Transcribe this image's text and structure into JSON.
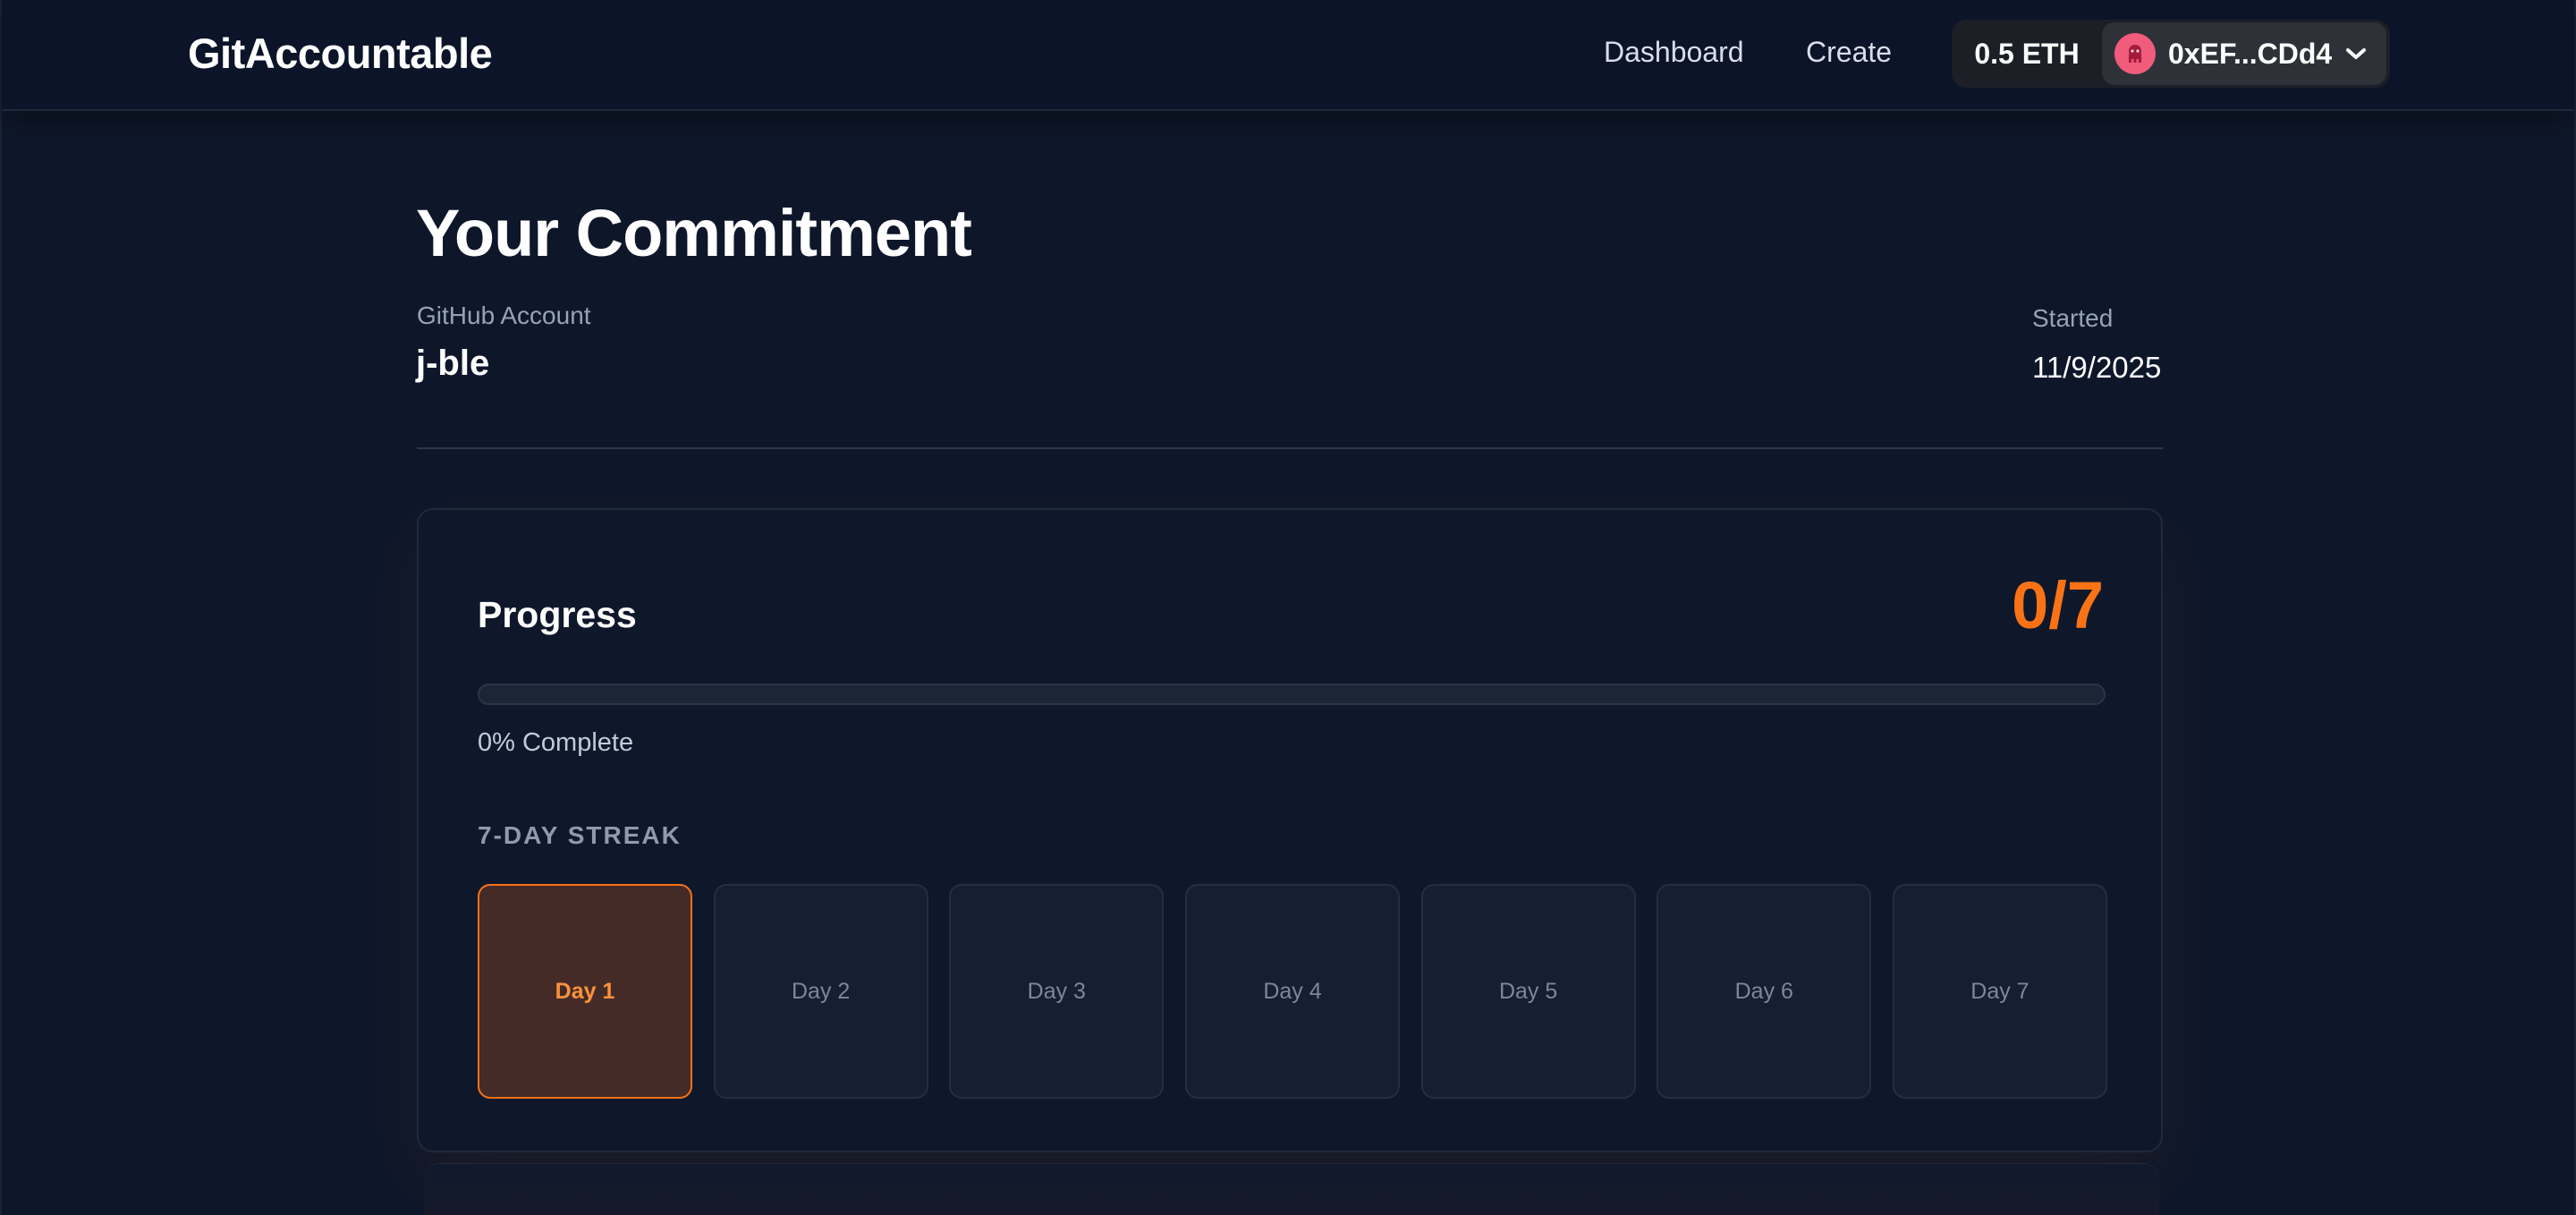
{
  "header": {
    "brand": "GitAccountable",
    "nav": {
      "dashboard": "Dashboard",
      "create": "Create"
    },
    "wallet": {
      "balance": "0.5 ETH",
      "address": "0xEF...CDd4",
      "avatar_icon": "octopus-icon",
      "avatar_color": "#f15b7c"
    }
  },
  "commitment": {
    "title": "Your Commitment",
    "github_label": "GitHub Account",
    "github_value": "j-ble",
    "started_label": "Started",
    "started_value": "11/9/2025"
  },
  "progress": {
    "heading": "Progress",
    "count": "0/7",
    "fraction": 0,
    "percent_text": "0% Complete",
    "accent_color": "#f97316",
    "streak_heading": "7-DAY STREAK",
    "days": [
      {
        "label": "Day 1",
        "active": true
      },
      {
        "label": "Day 2",
        "active": false
      },
      {
        "label": "Day 3",
        "active": false
      },
      {
        "label": "Day 4",
        "active": false
      },
      {
        "label": "Day 5",
        "active": false
      },
      {
        "label": "Day 6",
        "active": false
      },
      {
        "label": "Day 7",
        "active": false
      }
    ]
  }
}
